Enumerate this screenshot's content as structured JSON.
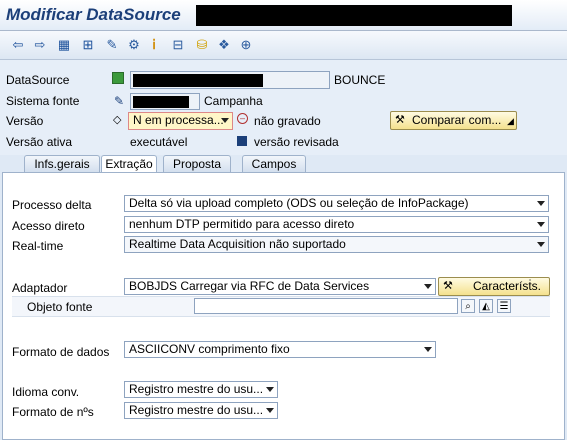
{
  "window": {
    "title": "Modificar DataSource"
  },
  "toolbar": {
    "icons": [
      "back-arrow-icon",
      "forward-arrow-icon",
      "display-icon",
      "hierarchy-icon",
      "edit-pencil-icon",
      "activate-icon",
      "where-used-icon",
      "structure-icon",
      "database-icon",
      "object-icon",
      "network-icon"
    ],
    "glyphs": {
      "back": "⇦",
      "forward": "⇨",
      "display": "▦",
      "hierarchy": "⊞",
      "edit": "✎",
      "activate": "⚙",
      "info": "ⅰ",
      "structure": "⊟",
      "database": "⛁",
      "cube": "❖",
      "network": "⊕"
    }
  },
  "header": {
    "datasource_label": "DataSource",
    "datasource_suffix": "BOUNCE",
    "source_system_label": "Sistema fonte",
    "source_system_desc": "Campanha",
    "version_label": "Versão",
    "version_value": "N em processa...",
    "version_status": "não gravado",
    "compare_button": "Comparar com...",
    "active_version_label": "Versão ativa",
    "active_version_value": "executável",
    "revised_version_text": "versão revisada"
  },
  "tabs": [
    {
      "label": "Infs.gerais"
    },
    {
      "label": "Extração"
    },
    {
      "label": "Proposta"
    },
    {
      "label": "Campos"
    }
  ],
  "extraction": {
    "delta_label": "Processo delta",
    "delta_value": "Delta só via upload completo (ODS ou seleção de InfoPackage)",
    "direct_access_label": "Acesso direto",
    "direct_access_value": "nenhum DTP permitido para acesso direto",
    "realtime_label": "Real-time",
    "realtime_value": "Realtime Data Acquisition não suportado",
    "adapter_label": "Adaptador",
    "adapter_value": "BOBJDS Carregar via RFC de Data Services",
    "properties_button": "Caracterísṫs.",
    "source_object_label": "Objeto fonte",
    "source_object_value": "",
    "data_format_label": "Formato de dados",
    "data_format_value": "ASCIICONV comprimento fixo",
    "conv_lang_label": "Idioma conv.",
    "conv_lang_value": "Registro mestre do usu...",
    "number_format_label": "Formato de nºs",
    "number_format_value": "Registro mestre do usu..."
  }
}
